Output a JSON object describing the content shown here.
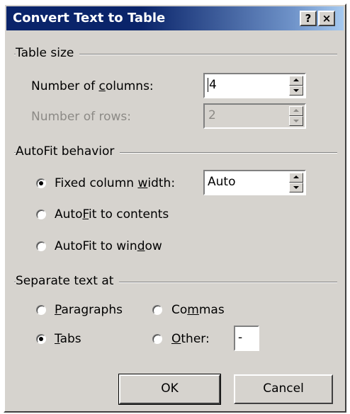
{
  "window": {
    "title": "Convert Text to Table",
    "help_label": "?",
    "close_label": "×"
  },
  "table_size": {
    "group_label": "Table size",
    "columns_label_pre": "Number of ",
    "columns_label_u": "c",
    "columns_label_post": "olumns:",
    "columns_value": "4",
    "rows_label": "Number of rows:",
    "rows_value": "2"
  },
  "autofit": {
    "group_label": "AutoFit behavior",
    "fixed_pre": "Fixed column ",
    "fixed_u": "w",
    "fixed_post": "idth:",
    "fixed_value": "Auto",
    "contents_pre": "Auto",
    "contents_u": "F",
    "contents_post": "it to contents",
    "window_pre": "AutoFit to win",
    "window_u": "d",
    "window_post": "ow",
    "selected": "fixed"
  },
  "separate": {
    "group_label": "Separate text at",
    "paragraphs_u": "P",
    "paragraphs_post": "aragraphs",
    "commas_pre": "Co",
    "commas_u": "m",
    "commas_post": "mas",
    "tabs_u": "T",
    "tabs_post": "abs",
    "other_u": "O",
    "other_post": "ther:",
    "other_value": "-",
    "selected": "tabs"
  },
  "buttons": {
    "ok": "OK",
    "cancel": "Cancel"
  }
}
